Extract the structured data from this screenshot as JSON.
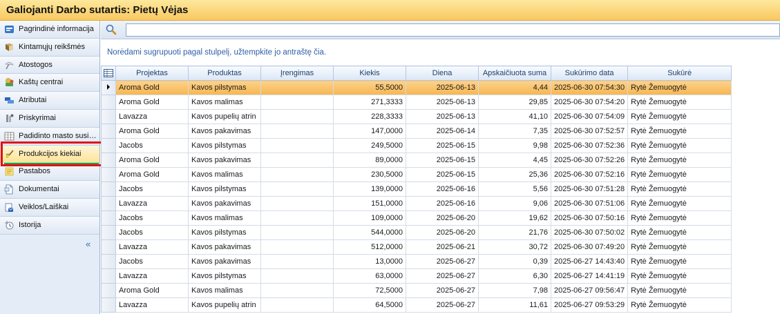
{
  "window": {
    "title": "Galiojanti Darbo sutartis: Pietų Vėjas"
  },
  "sidebar": {
    "items": [
      {
        "label": "Pagrindinė informacija",
        "icon": "info-card-icon"
      },
      {
        "label": "Kintamųjų reikšmės",
        "icon": "book-icon"
      },
      {
        "label": "Atostogos",
        "icon": "beach-icon"
      },
      {
        "label": "Kaštų centrai",
        "icon": "money-icon"
      },
      {
        "label": "Atributai",
        "icon": "attributes-icon"
      },
      {
        "label": "Priskyrimai",
        "icon": "assign-icon"
      },
      {
        "label": "Padidinto masto susi…",
        "icon": "table-icon"
      },
      {
        "label": "Produkcijos kiekiai",
        "icon": "brush-icon",
        "active": true
      },
      {
        "label": "Pastabos",
        "icon": "note-icon"
      },
      {
        "label": "Dokumentai",
        "icon": "document-icon"
      },
      {
        "label": "Veiklos/Laiškai",
        "icon": "mail-icon"
      },
      {
        "label": "Istorija",
        "icon": "history-icon"
      }
    ],
    "collapse_glyph": "«"
  },
  "search": {
    "value": "",
    "placeholder": ""
  },
  "grid": {
    "group_hint": "Norėdami sugrupuoti pagal stulpelį, užtempkite jo antraštę čia.",
    "columns": [
      "Projektas",
      "Produktas",
      "Įrengimas",
      "Kiekis",
      "Diena",
      "Apskaičiuota suma",
      "Sukūrimo data",
      "Sukūrė"
    ],
    "selected_row": 0,
    "rows": [
      [
        "Aroma Gold",
        "Kavos pilstymas",
        "",
        "55,5000",
        "2025-06-13",
        "4,44",
        "2025-06-30 07:54:30",
        "Rytė Žemuogytė"
      ],
      [
        "Aroma Gold",
        "Kavos malimas",
        "",
        "271,3333",
        "2025-06-13",
        "29,85",
        "2025-06-30 07:54:20",
        "Rytė Žemuogytė"
      ],
      [
        "Lavazza",
        "Kavos pupelių atrin",
        "",
        "228,3333",
        "2025-06-13",
        "41,10",
        "2025-06-30 07:54:09",
        "Rytė Žemuogytė"
      ],
      [
        "Aroma Gold",
        "Kavos pakavimas",
        "",
        "147,0000",
        "2025-06-14",
        "7,35",
        "2025-06-30 07:52:57",
        "Rytė Žemuogytė"
      ],
      [
        "Jacobs",
        "Kavos pilstymas",
        "",
        "249,5000",
        "2025-06-15",
        "9,98",
        "2025-06-30 07:52:36",
        "Rytė Žemuogytė"
      ],
      [
        "Aroma Gold",
        "Kavos pakavimas",
        "",
        "89,0000",
        "2025-06-15",
        "4,45",
        "2025-06-30 07:52:26",
        "Rytė Žemuogytė"
      ],
      [
        "Aroma Gold",
        "Kavos malimas",
        "",
        "230,5000",
        "2025-06-15",
        "25,36",
        "2025-06-30 07:52:16",
        "Rytė Žemuogytė"
      ],
      [
        "Jacobs",
        "Kavos pilstymas",
        "",
        "139,0000",
        "2025-06-16",
        "5,56",
        "2025-06-30 07:51:28",
        "Rytė Žemuogytė"
      ],
      [
        "Lavazza",
        "Kavos pakavimas",
        "",
        "151,0000",
        "2025-06-16",
        "9,06",
        "2025-06-30 07:51:06",
        "Rytė Žemuogytė"
      ],
      [
        "Jacobs",
        "Kavos malimas",
        "",
        "109,0000",
        "2025-06-20",
        "19,62",
        "2025-06-30 07:50:16",
        "Rytė Žemuogytė"
      ],
      [
        "Jacobs",
        "Kavos pilstymas",
        "",
        "544,0000",
        "2025-06-20",
        "21,76",
        "2025-06-30 07:50:02",
        "Rytė Žemuogytė"
      ],
      [
        "Lavazza",
        "Kavos pakavimas",
        "",
        "512,0000",
        "2025-06-21",
        "30,72",
        "2025-06-30 07:49:20",
        "Rytė Žemuogytė"
      ],
      [
        "Jacobs",
        "Kavos pakavimas",
        "",
        "13,0000",
        "2025-06-27",
        "0,39",
        "2025-06-27 14:43:40",
        "Rytė Žemuogytė"
      ],
      [
        "Lavazza",
        "Kavos pilstymas",
        "",
        "63,0000",
        "2025-06-27",
        "6,30",
        "2025-06-27 14:41:19",
        "Rytė Žemuogytė"
      ],
      [
        "Aroma Gold",
        "Kavos malimas",
        "",
        "72,5000",
        "2025-06-27",
        "7,98",
        "2025-06-27 09:56:47",
        "Rytė Žemuogytė"
      ],
      [
        "Lavazza",
        "Kavos pupelių atrin",
        "",
        "64,5000",
        "2025-06-27",
        "11,61",
        "2025-06-27 09:53:29",
        "Rytė Žemuogytė"
      ]
    ]
  },
  "colors": {
    "title_bar": "#f9c860",
    "selected_row": "#f6b651",
    "highlight_box": "#e3101a",
    "active_underline": "#19a82a",
    "hint_text": "#2d5fa6"
  }
}
